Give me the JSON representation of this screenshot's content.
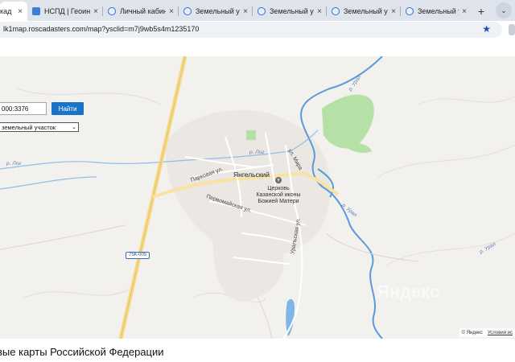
{
  "browser": {
    "tabs": [
      {
        "label": "кад",
        "active": true,
        "icon": "document-icon"
      },
      {
        "label": "НСПД | Геоинфо",
        "active": false,
        "icon": "globe-icon"
      },
      {
        "label": "Личный кабине",
        "active": false,
        "icon": "globe-icon"
      },
      {
        "label": "Земельный учас",
        "active": false,
        "icon": "globe-icon"
      },
      {
        "label": "Земельный уча",
        "active": false,
        "icon": "globe-icon"
      },
      {
        "label": "Земельный уча",
        "active": false,
        "icon": "globe-icon"
      },
      {
        "label": "Земельный уча",
        "active": false,
        "icon": "globe-icon"
      }
    ],
    "close_glyph": "×",
    "new_tab_glyph": "+",
    "url": "lk1map.roscadasters.com/map?ysclid=m7j9wb5s4m1235170",
    "bookmark_glyph": "★"
  },
  "search": {
    "value": "000:3376",
    "button_label": "Найти",
    "type_selected": "земельный участок",
    "type_caret": "⌄"
  },
  "map": {
    "town": "Янгельский",
    "streets": {
      "parkovaya": "Парковая ул.",
      "pervomayskaya": "Первомайская ул.",
      "mira": "ул. Мира",
      "uralskaya": "Уральская ул."
    },
    "rivers": {
      "log_upper": "р. Лог",
      "log_left": "р. Лог",
      "ural_top": "р. Урал",
      "ural_mid": "р. Урал",
      "ural_low": "р. Урал"
    },
    "poi": {
      "line1": "Церковь",
      "line2": "Казанской иконы",
      "line3": "Божией Матери"
    },
    "road_shield": "75К-005",
    "watermark": "Яндекс",
    "attribution": "© Яндекс",
    "terms_link": "Условия ис"
  },
  "footer_title": "вые карты Российской Федерации",
  "colors": {
    "accent": "#1a73c9",
    "water": "#5a9ad8",
    "park": "#b6e1a6",
    "road_major": "#f5d986"
  }
}
